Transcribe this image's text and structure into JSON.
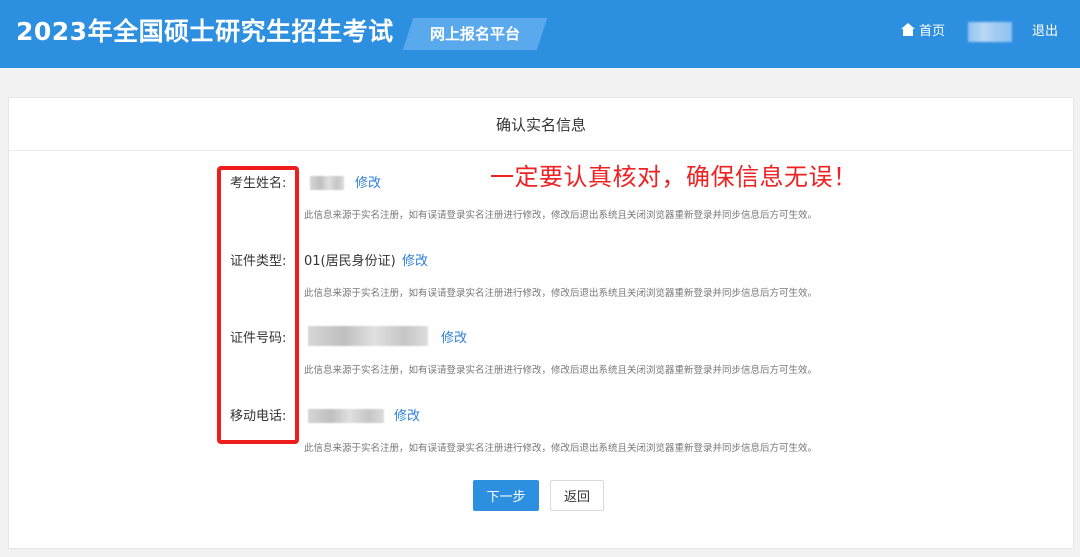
{
  "header": {
    "title": "2023年全国硕士研究生招生考试",
    "platform": "网上报名平台",
    "home_label": "首页",
    "logout_label": "退出"
  },
  "page": {
    "title": "确认实名信息",
    "warning": "一定要认真核对，确保信息无误！"
  },
  "fields": [
    {
      "label": "考生姓名:",
      "value": "",
      "edit_label": "修改"
    },
    {
      "label": "证件类型:",
      "value": "01(居民身份证)",
      "edit_label": "修改"
    },
    {
      "label": "证件号码:",
      "value": "",
      "edit_label": "修改"
    },
    {
      "label": "移动电话:",
      "value": "",
      "edit_label": "修改"
    }
  ],
  "note": "此信息来源于实名注册，如有误请登录实名注册进行修改，修改后退出系统且关闭浏览器重新登录并同步信息后方可生效。",
  "buttons": {
    "next": "下一步",
    "back": "返回"
  },
  "colors": {
    "header_bg": "#2d8fe0",
    "platform_tag_bg": "#5aa9ec",
    "link": "#2d7fd8",
    "warning": "#ee2222",
    "highlight_border": "#ee1c1c",
    "primary_button": "#2d8fe0"
  },
  "icons": {
    "home": "home-icon"
  }
}
